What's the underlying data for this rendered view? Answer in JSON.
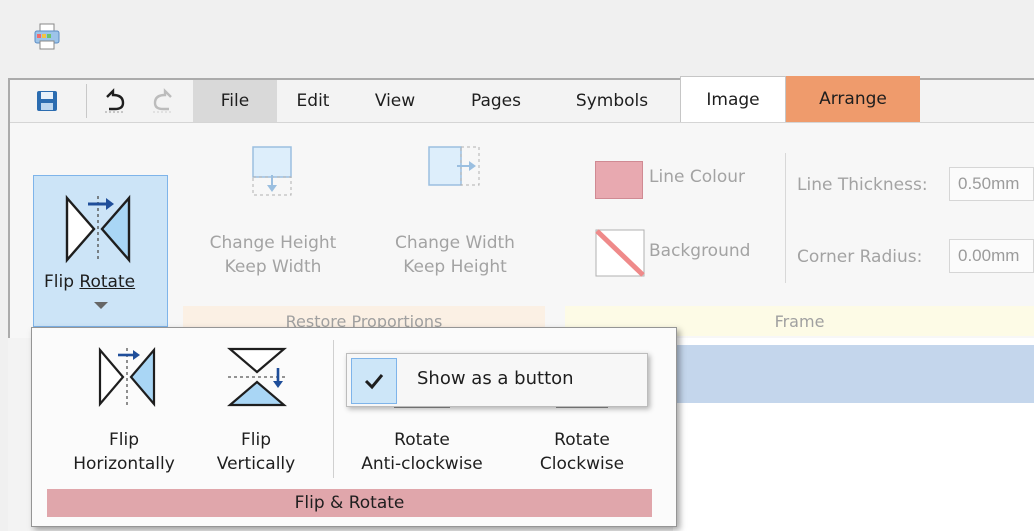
{
  "title_bar": {
    "app_icon": "printer-icon"
  },
  "quick_access": {
    "save_icon": "save-icon",
    "undo_icon": "undo-icon",
    "redo_icon": "redo-icon"
  },
  "tabs": [
    {
      "label": "File"
    },
    {
      "label": "Edit"
    },
    {
      "label": "View"
    },
    {
      "label": "Pages"
    },
    {
      "label": "Symbols"
    },
    {
      "label": "Image"
    },
    {
      "label": "Arrange"
    }
  ],
  "ribbon": {
    "flip_rotate": {
      "label": "Flip",
      "label2": "Rotate",
      "icon": "flip-rotate-icon"
    },
    "restore_proportions": {
      "group_label": "Restore Proportions",
      "change_height": {
        "line1": "Change Height",
        "line2": "Keep Width",
        "icon": "change-height-icon"
      },
      "change_width": {
        "line1": "Change Width",
        "line2": "Keep Height",
        "icon": "change-width-icon"
      }
    },
    "frame": {
      "group_label": "Frame",
      "line_colour": "Line Colour",
      "background": "Background",
      "line_thickness_label": "Line Thickness:",
      "line_thickness_value": "0.50mm",
      "corner_radius_label": "Corner Radius:",
      "corner_radius_value": "0.00mm"
    }
  },
  "popup": {
    "group_label": "Flip & Rotate",
    "items": [
      {
        "line1": "Flip",
        "line2": "Horizontally",
        "icon": "flip-horizontal-icon"
      },
      {
        "line1": "Flip",
        "line2": "Vertically",
        "icon": "flip-vertical-icon"
      },
      {
        "line1": "Rotate",
        "line2": "Anti-clockwise",
        "icon": "rotate-anticlockwise-icon"
      },
      {
        "line1": "Rotate",
        "line2": "Clockwise",
        "icon": "rotate-clockwise-icon"
      }
    ]
  },
  "context_menu": {
    "show_as_button": "Show as a button",
    "checked": true
  },
  "colors": {
    "accent_blue": "#cce4f7",
    "arrange_tab": "#ef9b6c",
    "flip_rotate_group": "#e0a6ab",
    "line_colour_swatch": "#e8a9b0",
    "frame_group_bg": "#fdfbe6",
    "restore_group_bg": "#fbf0e4"
  }
}
